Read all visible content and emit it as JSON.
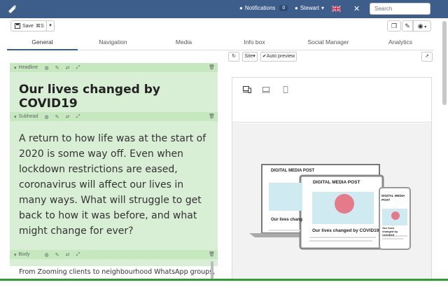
{
  "topbar": {
    "notifications_label": "Notifications",
    "notifications_count": "0",
    "user_label": "Stewart",
    "search_placeholder": "Search"
  },
  "toolbar": {
    "save_label": "Save",
    "save_shortcut": "⌘S"
  },
  "tabs": [
    {
      "label": "General",
      "active": true
    },
    {
      "label": "Navigation",
      "active": false
    },
    {
      "label": "Media",
      "active": false
    },
    {
      "label": "Info box",
      "active": false
    },
    {
      "label": "Social Manager",
      "active": false
    },
    {
      "label": "Analytics",
      "active": false
    }
  ],
  "preview_controls": {
    "site_label": "Site",
    "auto_preview_label": "Auto preview"
  },
  "fields": {
    "headline_label": "Headline",
    "subhead_label": "Subhead",
    "body_label": "Body"
  },
  "article": {
    "headline": "Our lives changed by COVID19",
    "subhead": "A return to how life was at the start of 2020 is some way off. Even when lockdown restrictions are eased, coronavirus will affect our lives in many ways. What will struggle to get back to how it was before, and what might change for ever?",
    "body_first_line": "From Zooming clients to neighbourhood WhatsApp groups,"
  },
  "preview": {
    "site_name": "DIGITAL MEDIA POST",
    "headline": "Our lives changed by COVID19",
    "headline_short": "Our lives chang",
    "mobile_headline": "Our lives changed by COVID19"
  },
  "colors": {
    "topbar": "#3d5d8a",
    "editor_bg": "#d9efd5",
    "field_bar": "#c5e8bf",
    "accent_green": "#2fa02f"
  }
}
